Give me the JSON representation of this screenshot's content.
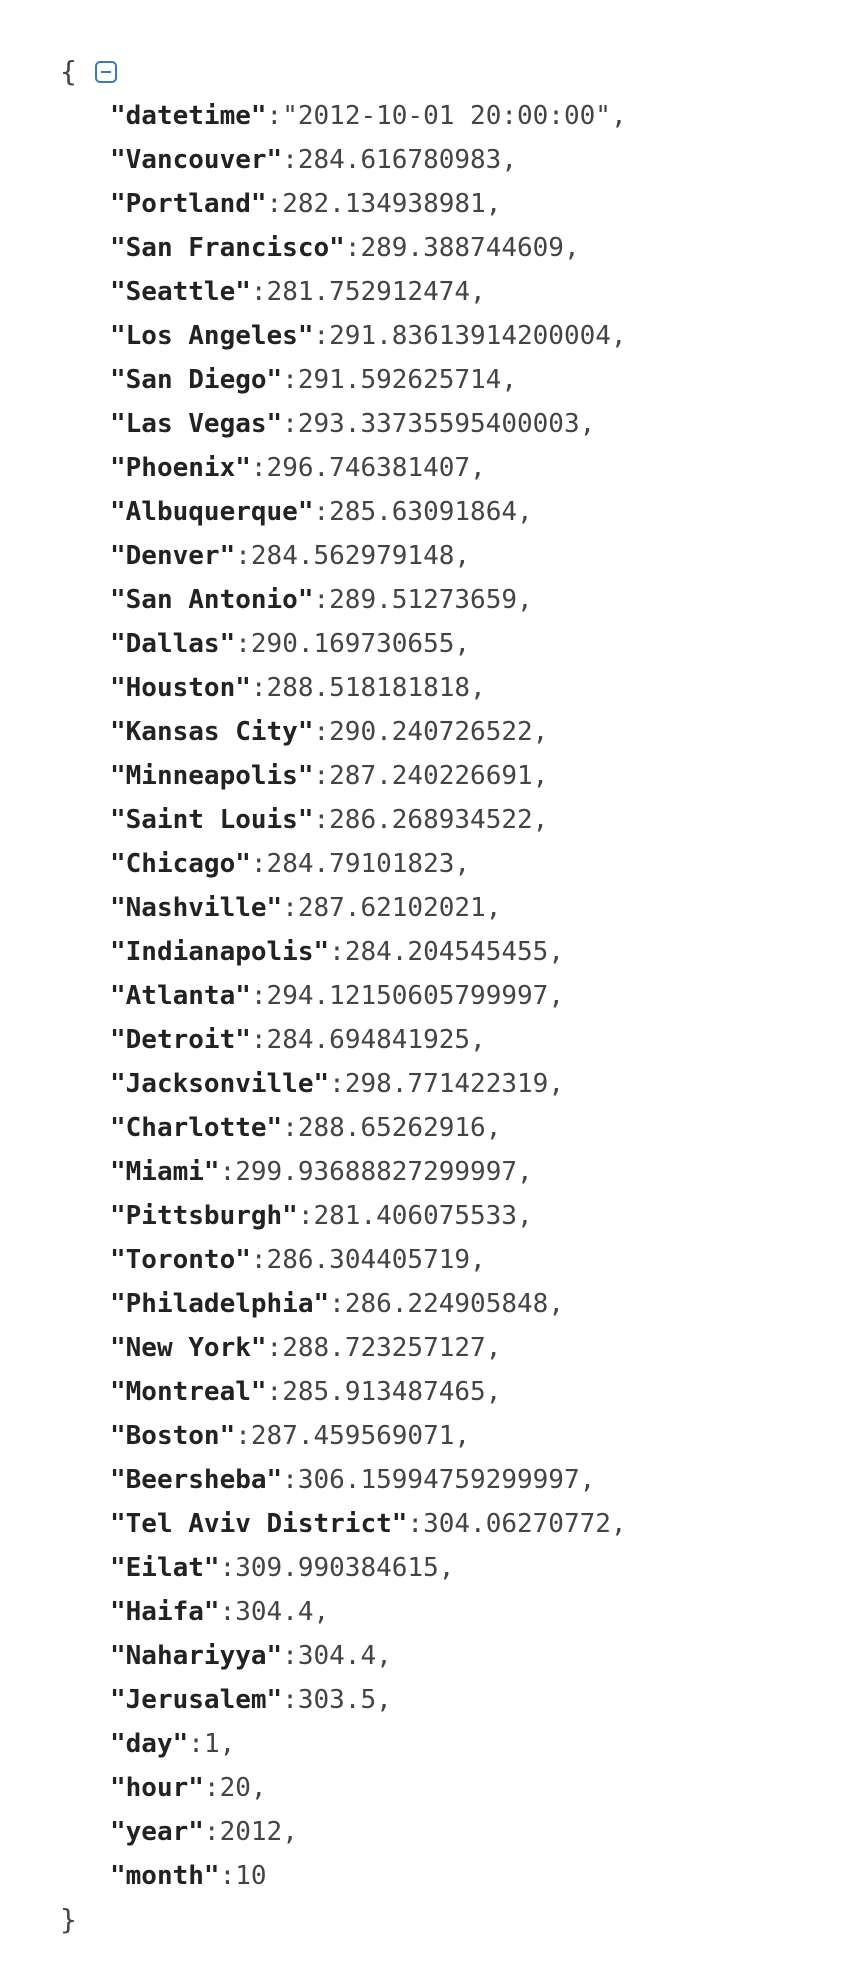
{
  "viewer": {
    "open_brace": "{",
    "close_brace": "}",
    "collapse_icon": "collapse-minus-icon",
    "accent_color": "#3b78c2",
    "entries": [
      {
        "key": "\"datetime\"",
        "value": "\"2012-10-01 20:00:00\""
      },
      {
        "key": "\"Vancouver\"",
        "value": "284.616780983"
      },
      {
        "key": "\"Portland\"",
        "value": "282.134938981"
      },
      {
        "key": "\"San Francisco\"",
        "value": "289.388744609"
      },
      {
        "key": "\"Seattle\"",
        "value": "281.752912474"
      },
      {
        "key": "\"Los Angeles\"",
        "value": "291.83613914200004"
      },
      {
        "key": "\"San Diego\"",
        "value": "291.592625714"
      },
      {
        "key": "\"Las Vegas\"",
        "value": "293.33735595400003"
      },
      {
        "key": "\"Phoenix\"",
        "value": "296.746381407"
      },
      {
        "key": "\"Albuquerque\"",
        "value": "285.63091864"
      },
      {
        "key": "\"Denver\"",
        "value": "284.562979148"
      },
      {
        "key": "\"San Antonio\"",
        "value": "289.51273659"
      },
      {
        "key": "\"Dallas\"",
        "value": "290.169730655"
      },
      {
        "key": "\"Houston\"",
        "value": "288.518181818"
      },
      {
        "key": "\"Kansas City\"",
        "value": "290.240726522"
      },
      {
        "key": "\"Minneapolis\"",
        "value": "287.240226691"
      },
      {
        "key": "\"Saint Louis\"",
        "value": "286.268934522"
      },
      {
        "key": "\"Chicago\"",
        "value": "284.79101823"
      },
      {
        "key": "\"Nashville\"",
        "value": "287.62102021"
      },
      {
        "key": "\"Indianapolis\"",
        "value": "284.204545455"
      },
      {
        "key": "\"Atlanta\"",
        "value": "294.12150605799997"
      },
      {
        "key": "\"Detroit\"",
        "value": "284.694841925"
      },
      {
        "key": "\"Jacksonville\"",
        "value": "298.771422319"
      },
      {
        "key": "\"Charlotte\"",
        "value": "288.65262916"
      },
      {
        "key": "\"Miami\"",
        "value": "299.93688827299997"
      },
      {
        "key": "\"Pittsburgh\"",
        "value": "281.406075533"
      },
      {
        "key": "\"Toronto\"",
        "value": "286.304405719"
      },
      {
        "key": "\"Philadelphia\"",
        "value": "286.224905848"
      },
      {
        "key": "\"New York\"",
        "value": "288.723257127"
      },
      {
        "key": "\"Montreal\"",
        "value": "285.913487465"
      },
      {
        "key": "\"Boston\"",
        "value": "287.459569071"
      },
      {
        "key": "\"Beersheba\"",
        "value": "306.15994759299997"
      },
      {
        "key": "\"Tel Aviv District\"",
        "value": "304.06270772"
      },
      {
        "key": "\"Eilat\"",
        "value": "309.990384615"
      },
      {
        "key": "\"Haifa\"",
        "value": "304.4"
      },
      {
        "key": "\"Nahariyya\"",
        "value": "304.4"
      },
      {
        "key": "\"Jerusalem\"",
        "value": "303.5"
      },
      {
        "key": "\"day\"",
        "value": "1"
      },
      {
        "key": "\"hour\"",
        "value": "20"
      },
      {
        "key": "\"year\"",
        "value": "2012"
      },
      {
        "key": "\"month\"",
        "value": "10"
      }
    ]
  }
}
